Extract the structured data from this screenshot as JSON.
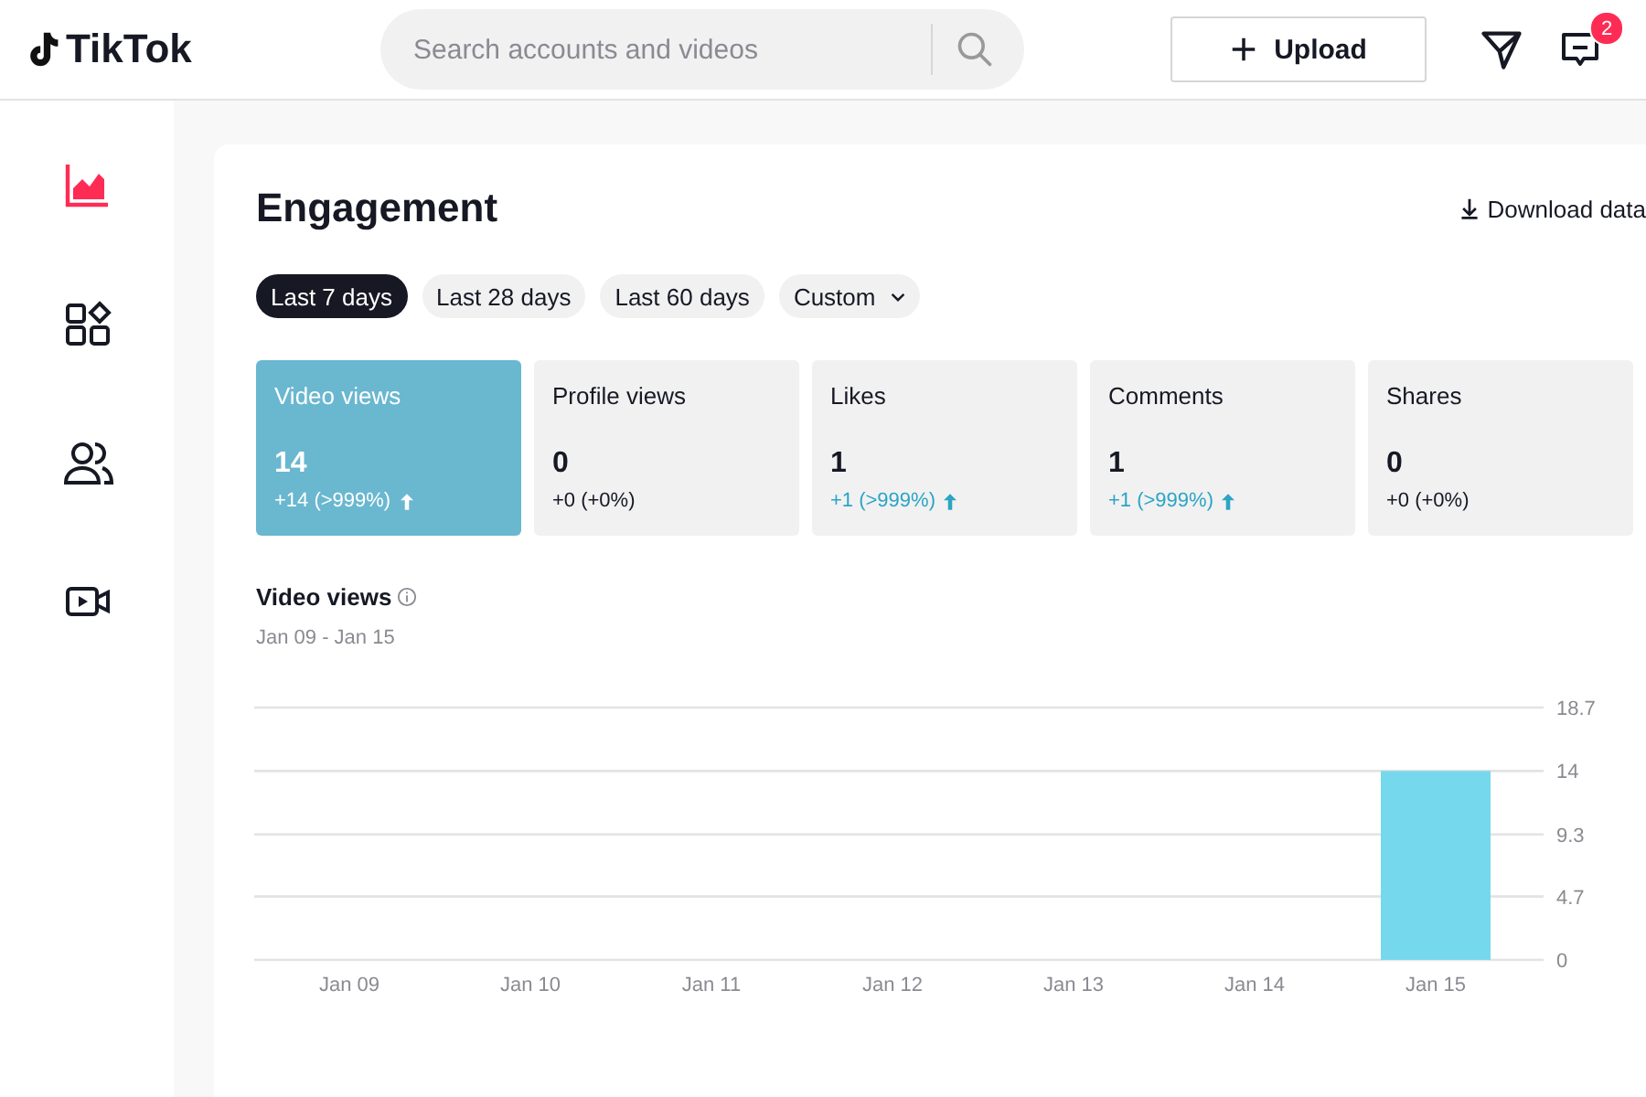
{
  "header": {
    "logo": "TikTok",
    "search": {
      "placeholder": "Search accounts and videos"
    },
    "upload": "Upload",
    "notification_count": "2"
  },
  "sidebar": {
    "items": [
      {
        "kind": "analytics",
        "selected": true
      },
      {
        "kind": "content",
        "selected": false
      },
      {
        "kind": "followers",
        "selected": false
      },
      {
        "kind": "live",
        "selected": false
      }
    ]
  },
  "title": "Engagement",
  "download": "Download data",
  "ranges": [
    {
      "label": "Last 7 days",
      "selected": true,
      "dropdown": false
    },
    {
      "label": "Last 28 days",
      "selected": false,
      "dropdown": false
    },
    {
      "label": "Last 60 days",
      "selected": false,
      "dropdown": false
    },
    {
      "label": "Custom",
      "selected": false,
      "dropdown": true
    }
  ],
  "metrics": [
    {
      "label": "Video views",
      "value": "14",
      "change": "+14 (>999%)",
      "rising": true,
      "selected": true
    },
    {
      "label": "Profile views",
      "value": "0",
      "change": "+0 (+0%)",
      "rising": false,
      "selected": false
    },
    {
      "label": "Likes",
      "value": "1",
      "change": "+1 (>999%)",
      "rising": true,
      "selected": false
    },
    {
      "label": "Comments",
      "value": "1",
      "change": "+1 (>999%)",
      "rising": true,
      "selected": false
    },
    {
      "label": "Shares",
      "value": "0",
      "change": "+0 (+0%)",
      "rising": false,
      "selected": false
    }
  ],
  "chart": {
    "title": "Video views",
    "range": "Jan 09 - Jan 15",
    "chart_data": {
      "type": "bar",
      "categories": [
        "Jan 09",
        "Jan 10",
        "Jan 11",
        "Jan 12",
        "Jan 13",
        "Jan 14",
        "Jan 15"
      ],
      "series": [
        {
          "color": "#76d8ec",
          "values": [
            0,
            0,
            0,
            0,
            0,
            0,
            14
          ]
        }
      ],
      "ylim": [
        0,
        18.7
      ],
      "yticks": [
        0,
        4.7,
        9.3,
        14,
        18.7
      ],
      "grid": true
    }
  }
}
